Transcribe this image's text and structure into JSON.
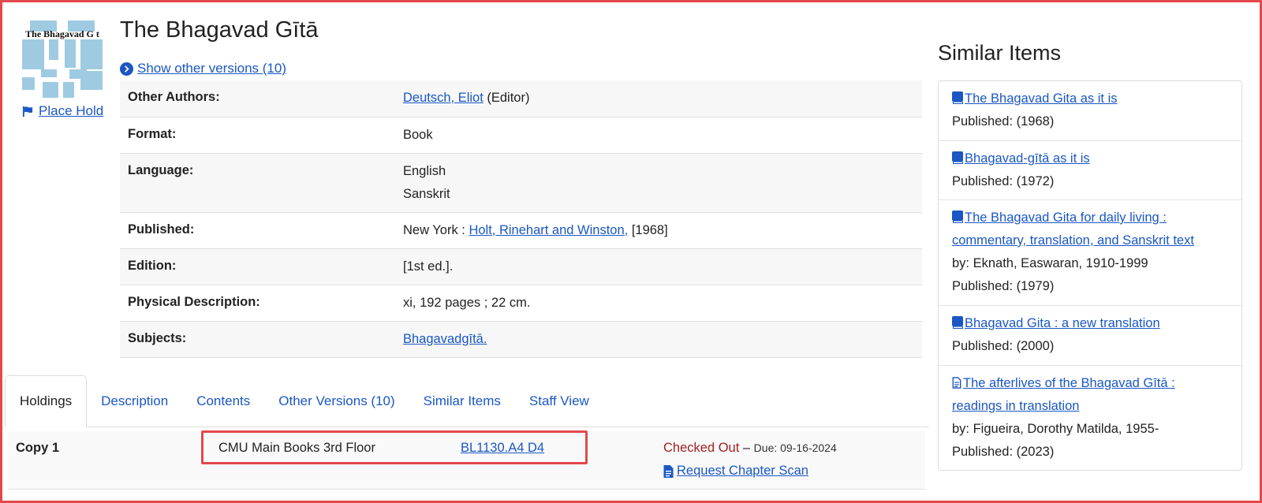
{
  "record": {
    "cover_text": "The Bhagavad G  t",
    "place_hold": "Place Hold",
    "title": "The Bhagavad Gītā",
    "show_versions": "Show other versions (10)"
  },
  "details": [
    {
      "label": "Other Authors:",
      "link": "Deutsch, Eliot",
      "suffix": " (Editor)"
    },
    {
      "label": "Format:",
      "value": "Book"
    },
    {
      "label": "Language:",
      "lines": [
        "English",
        "Sanskrit"
      ]
    },
    {
      "label": "Published:",
      "prefix": "New York : ",
      "link": "Holt, Rinehart and Winston,",
      "suffix": " [1968]"
    },
    {
      "label": "Edition:",
      "value": "[1st ed.]."
    },
    {
      "label": "Physical Description:",
      "value": "xi, 192 pages ; 22 cm."
    },
    {
      "label": "Subjects:",
      "link": "Bhagavadgītā."
    }
  ],
  "tabs": [
    {
      "label": "Holdings",
      "active": true
    },
    {
      "label": "Description"
    },
    {
      "label": "Contents"
    },
    {
      "label": "Other Versions (10)"
    },
    {
      "label": "Similar Items"
    },
    {
      "label": "Staff View"
    }
  ],
  "holdings": {
    "copy": "Copy 1",
    "location": "CMU Main Books 3rd Floor",
    "call_number": "BL1130.A4 D4",
    "status": "Checked Out",
    "due_dash": " – ",
    "due": "Due: 09-16-2024",
    "request": "Request Chapter Scan"
  },
  "similar": {
    "heading": "Similar Items",
    "items": [
      {
        "icon": "book-icon",
        "title": "The Bhagavad Gita as it is",
        "published": "Published: (1968)"
      },
      {
        "icon": "book-icon",
        "title": "Bhagavad-gītā as it is",
        "published": "Published: (1972)"
      },
      {
        "icon": "book-icon",
        "title": "The Bhagavad Gita for daily living : commentary, translation, and Sanskrit text",
        "by": "by: Eknath, Easwaran, 1910-1999",
        "published": "Published: (1979)"
      },
      {
        "icon": "book-icon",
        "title": "Bhagavad Gita : a new translation",
        "published": "Published: (2000)"
      },
      {
        "icon": "file-text-icon",
        "title": "The afterlives of the Bhagavad Gītā : readings in translation",
        "by": "by: Figueira, Dorothy Matilda, 1955-",
        "published": "Published: (2023)"
      }
    ]
  },
  "colors": {
    "link": "#1a57c4",
    "checked_out": "#a31f1f",
    "highlight": "#e2484c",
    "cover": "#9ecbe2"
  }
}
